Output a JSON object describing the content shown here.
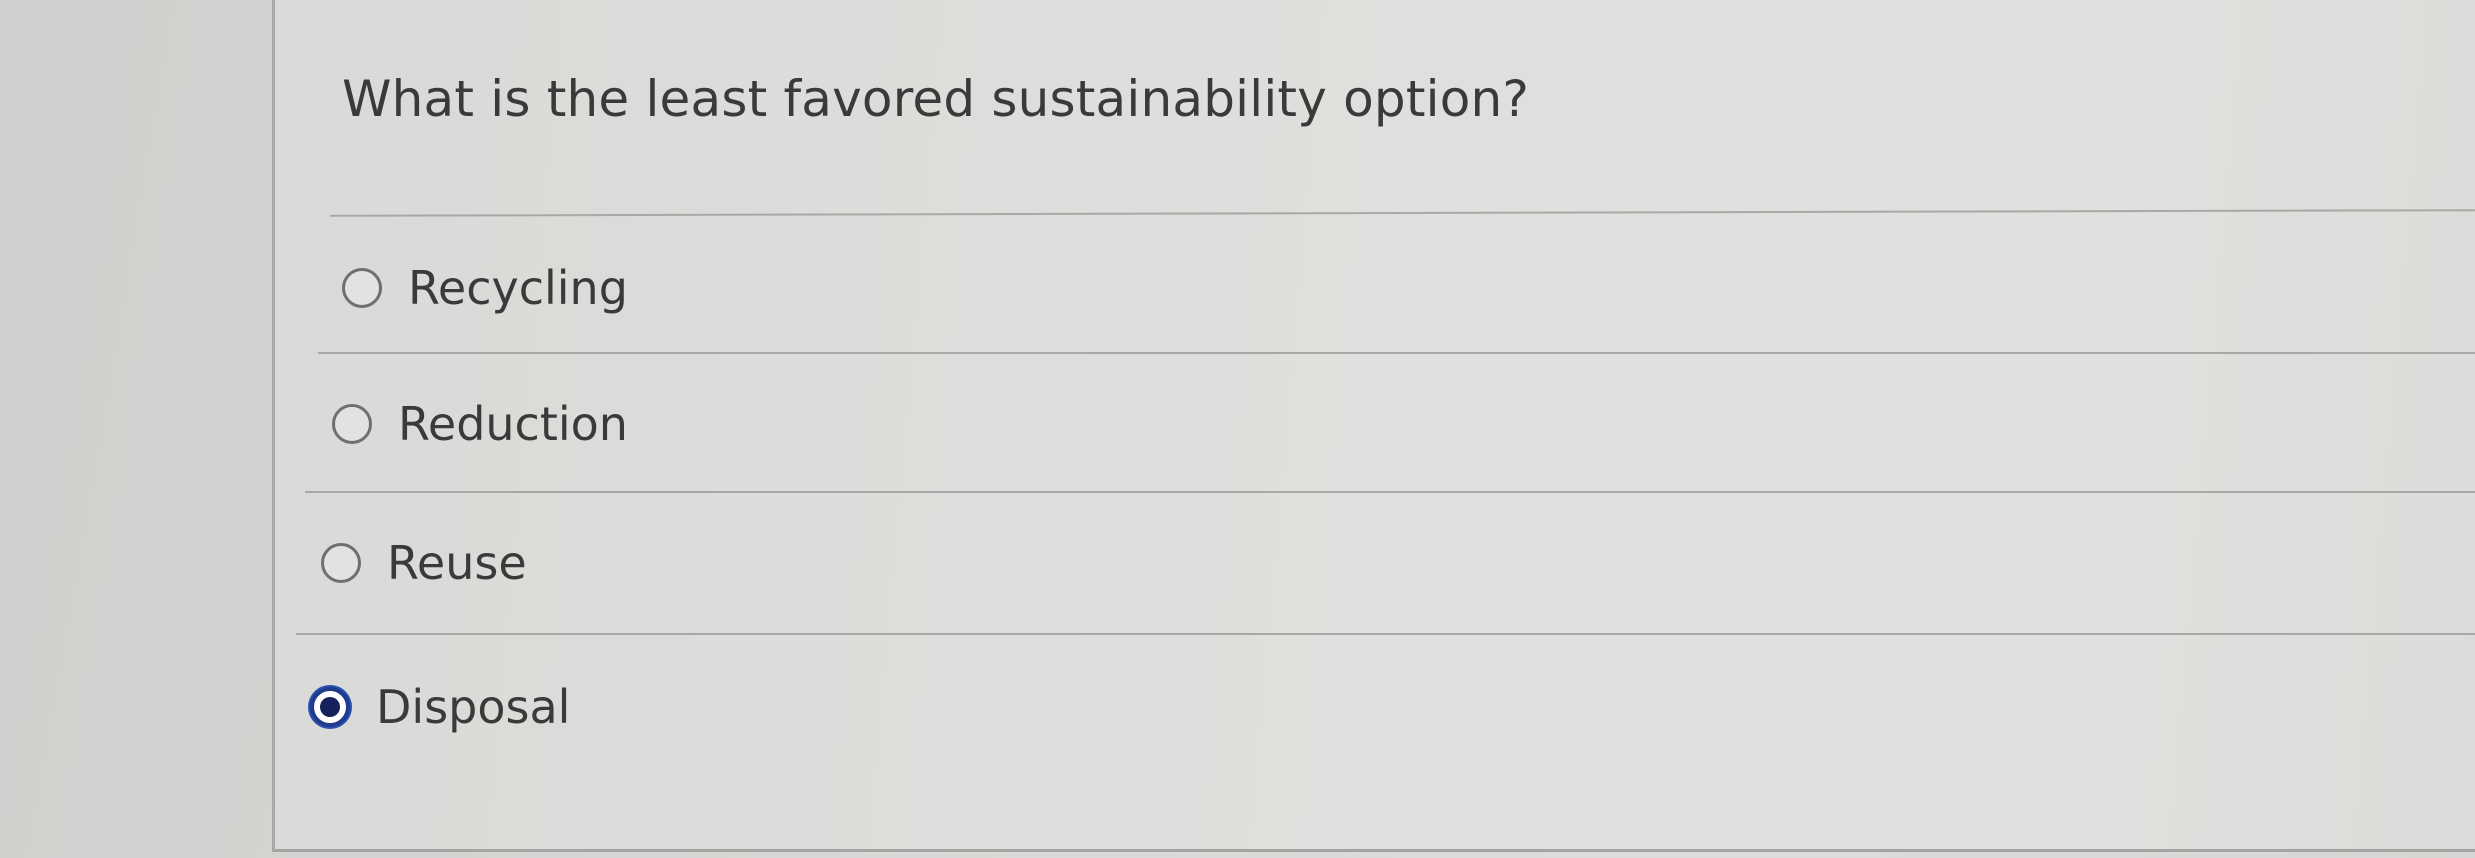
{
  "question": {
    "text": "What is the least favored sustainability option?"
  },
  "options": [
    {
      "label": "Recycling",
      "selected": false
    },
    {
      "label": "Reduction",
      "selected": false
    },
    {
      "label": "Reuse",
      "selected": false
    },
    {
      "label": "Disposal",
      "selected": true
    }
  ],
  "colors": {
    "selected_radio": "#1f3b8c",
    "text": "#3a3a3a"
  }
}
